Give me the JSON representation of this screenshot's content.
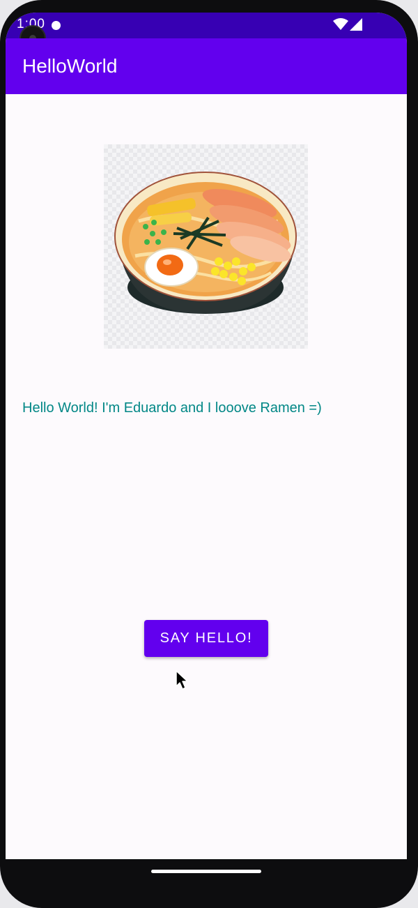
{
  "status_bar": {
    "time": "1:00",
    "background": "#3700b3",
    "icons": [
      "notification-icon",
      "wifi-icon",
      "signal-icon"
    ]
  },
  "app_bar": {
    "title": "HelloWorld",
    "background": "#6200ee"
  },
  "main": {
    "image_subject": "bowl of ramen with egg, chashu pork, seaweed and corn",
    "hello_text": "Hello World! I'm Eduardo and I looove Ramen =)",
    "hello_text_color": "#018786",
    "button_label": "SAY HELLO!",
    "button_color": "#6200ee"
  },
  "nav": {
    "icon": "home-handle"
  }
}
